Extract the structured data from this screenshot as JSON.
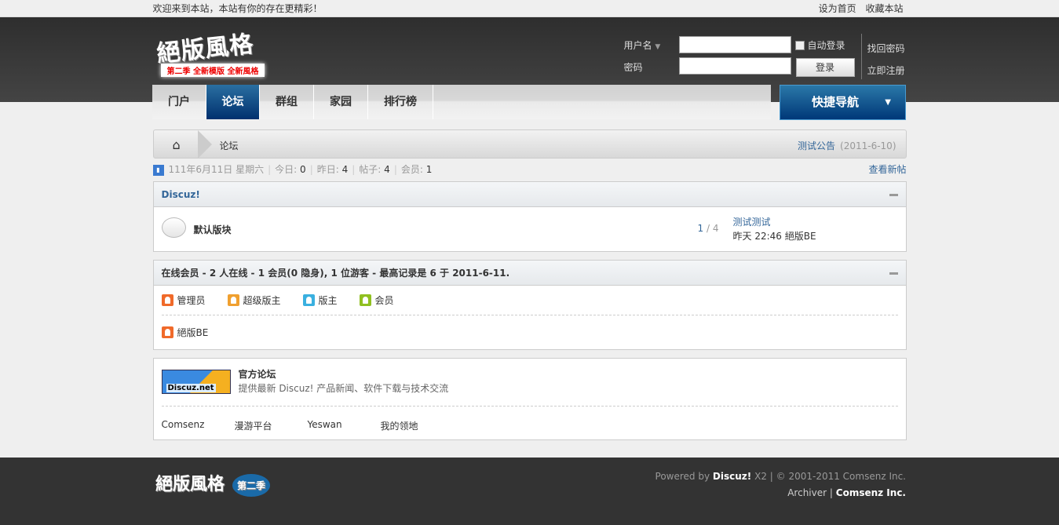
{
  "topbar": {
    "welcome": "欢迎来到本站，本站有你的存在更精彩！",
    "set_home": "设为首页",
    "bookmark": "收藏本站"
  },
  "header": {
    "logo": "絕版風格",
    "logo_ribbon": "第二季 全新模版 全新風格"
  },
  "login": {
    "username_label": "用户名",
    "password_label": "密码",
    "username_value": "",
    "password_value": "",
    "auto_login": "自动登录",
    "login_button": "登录",
    "forgot": "找回密码",
    "register": "立即注册"
  },
  "nav": {
    "items": [
      {
        "label": "门户"
      },
      {
        "label": "论坛"
      },
      {
        "label": "群组"
      },
      {
        "label": "家园"
      },
      {
        "label": "排行榜"
      }
    ],
    "quick_nav": "快捷导航"
  },
  "breadcrumb": {
    "current": "论坛",
    "announcement": "测试公告",
    "announcement_date": "(2011-6-10)"
  },
  "stats": {
    "date": "111年6月11日 星期六",
    "today_label": "今日:",
    "today": "0",
    "yesterday_label": "昨日:",
    "yesterday": "4",
    "posts_label": "帖子:",
    "posts": "4",
    "members_label": "会员:",
    "members": "1",
    "view_new": "查看新帖"
  },
  "category": {
    "title": "Discuz!",
    "forum": {
      "name": "默认版块",
      "threads": "1",
      "posts": "/ 4",
      "last_title": "测试测试",
      "last_info": "昨天 22:46 絕版BE"
    }
  },
  "online": {
    "title": "在线会员 - 2 人在线 - 1 会员(0 隐身), 1 位游客 - 最高记录是 6 于 2011-6-11.",
    "legend": [
      {
        "label": "管理员",
        "color": "#f06a2a"
      },
      {
        "label": "超级版主",
        "color": "#f0a030"
      },
      {
        "label": "版主",
        "color": "#3ab0e0"
      },
      {
        "label": "会员",
        "color": "#90c020"
      }
    ],
    "users": [
      {
        "name": "絕版BE",
        "color": "#f06a2a"
      }
    ]
  },
  "links": {
    "logo_text": "Discuz.net",
    "title": "官方论坛",
    "desc": "提供最新 Discuz! 产品新闻、软件下载与技术交流",
    "items": [
      "Comsenz",
      "漫游平台",
      "Yeswan",
      "我的领地"
    ]
  },
  "footer": {
    "logo": "絕版風格",
    "season": "第二季",
    "powered": "Powered by",
    "discuz": "Discuz!",
    "version": "X2",
    "copyright": "| © 2001-2011 Comsenz Inc.",
    "archiver": "Archiver",
    "sep": "|",
    "company": "Comsenz Inc."
  }
}
